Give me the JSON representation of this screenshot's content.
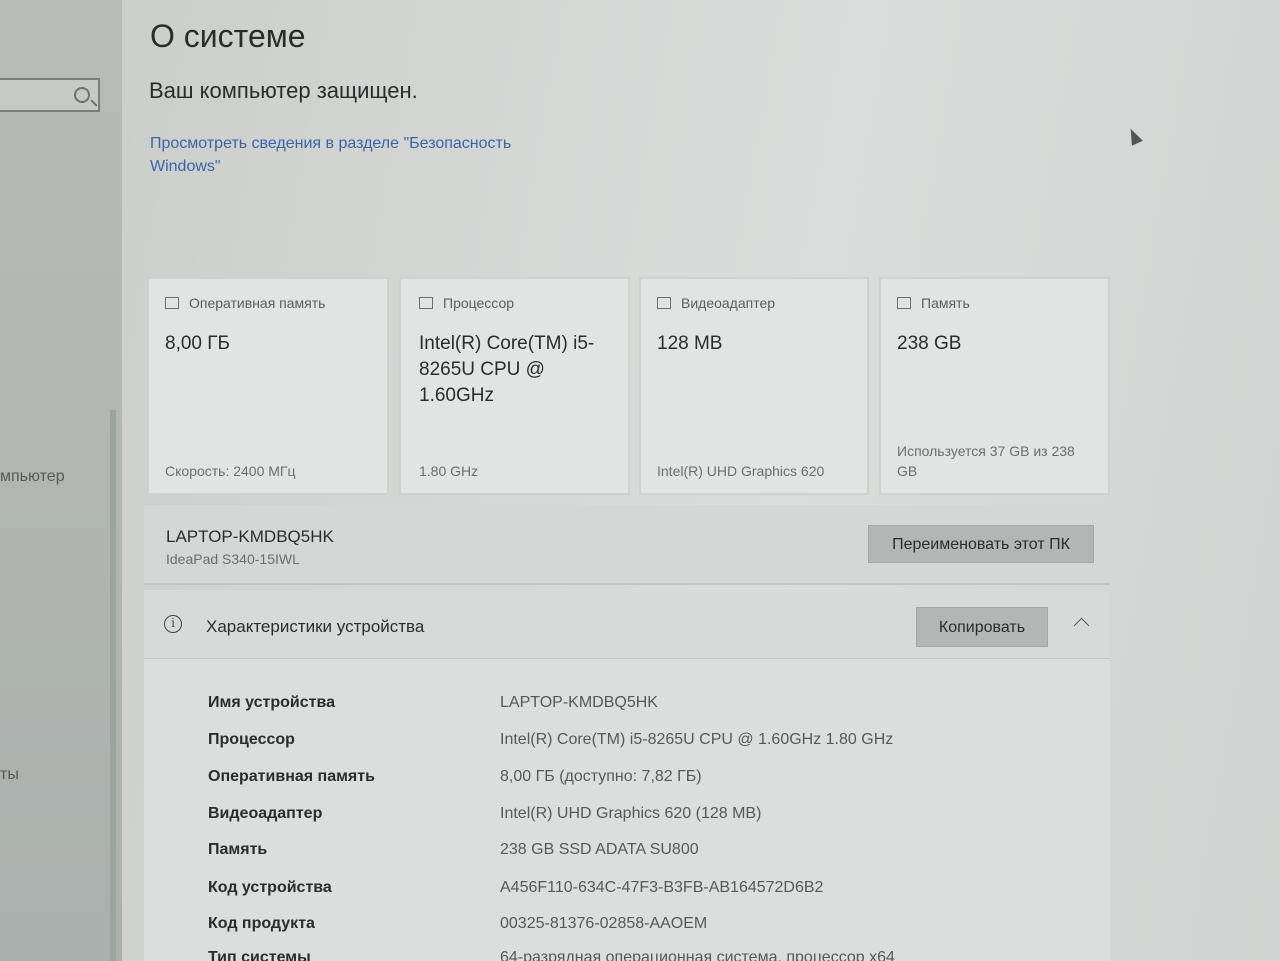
{
  "sidebar": {
    "search_placeholder": "",
    "items": [
      {
        "label": "мпьютер"
      },
      {
        "label": "ты"
      }
    ]
  },
  "page": {
    "title": "О системе",
    "protected_text": "Ваш компьютер защищен.",
    "security_link": "Просмотреть сведения в разделе \"Безопасность Windows\""
  },
  "cards": [
    {
      "icon": "memory-icon",
      "title": "Оперативная память",
      "value": "8,00 ГБ",
      "sub": "Скорость: 2400 МГц"
    },
    {
      "icon": "cpu-icon",
      "title": "Процессор",
      "value": "Intel(R) Core(TM) i5-8265U CPU @ 1.60GHz",
      "sub": "1.80 GHz"
    },
    {
      "icon": "gpu-icon",
      "title": "Видеоадаптер",
      "value": "128 MB",
      "sub": "Intel(R) UHD Graphics 620"
    },
    {
      "icon": "storage-icon",
      "title": "Память",
      "value": "238 GB",
      "sub": "Используется 37 GB из 238 GB"
    }
  ],
  "device": {
    "name": "LAPTOP-KMDBQ5HK",
    "model": "IdeaPad S340-15IWL",
    "rename_label": "Переименовать этот ПК"
  },
  "specs": {
    "title": "Характеристики устройства",
    "copy_label": "Копировать",
    "rows": [
      {
        "key": "Имя устройства",
        "value": "LAPTOP-KMDBQ5HK"
      },
      {
        "key": "Процессор",
        "value": "Intel(R) Core(TM) i5-8265U CPU @ 1.60GHz   1.80 GHz"
      },
      {
        "key": "Оперативная память",
        "value": "8,00 ГБ (доступно: 7,82 ГБ)"
      },
      {
        "key": "Видеоадаптер",
        "value": "Intel(R) UHD Graphics 620 (128 MB)"
      },
      {
        "key": "Память",
        "value": "238 GB SSD ADATA SU800"
      },
      {
        "key": "Код устройства",
        "value": "A456F110-634C-47F3-B3FB-AB164572D6B2"
      },
      {
        "key": "Код продукта",
        "value": "00325-81376-02858-AAOEM"
      },
      {
        "key": "Тип системы",
        "value": "64-разрядная операционная система, процессор x64"
      }
    ]
  }
}
